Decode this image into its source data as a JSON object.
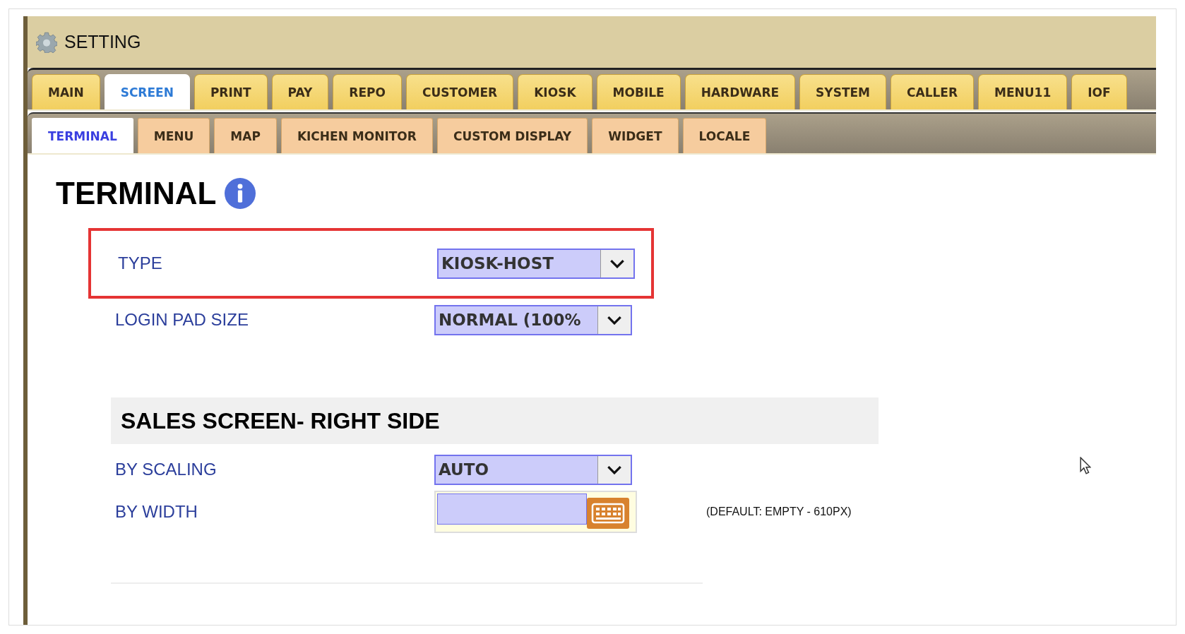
{
  "window": {
    "title": "SETTING"
  },
  "main_tabs": [
    {
      "label": "MAIN",
      "selected": false
    },
    {
      "label": "SCREEN",
      "selected": true
    },
    {
      "label": "PRINT",
      "selected": false
    },
    {
      "label": "PAY",
      "selected": false
    },
    {
      "label": "REPO",
      "selected": false
    },
    {
      "label": "CUSTOMER",
      "selected": false
    },
    {
      "label": "KIOSK",
      "selected": false
    },
    {
      "label": "MOBILE",
      "selected": false
    },
    {
      "label": "HARDWARE",
      "selected": false
    },
    {
      "label": "SYSTEM",
      "selected": false
    },
    {
      "label": "CALLER",
      "selected": false
    },
    {
      "label": "MENU11",
      "selected": false
    },
    {
      "label": "IOF",
      "selected": false
    }
  ],
  "sub_tabs": [
    {
      "label": "TERMINAL",
      "selected": true
    },
    {
      "label": "MENU",
      "selected": false
    },
    {
      "label": "MAP",
      "selected": false
    },
    {
      "label": "KICHEN MONITOR",
      "selected": false
    },
    {
      "label": "CUSTOM DISPLAY",
      "selected": false
    },
    {
      "label": "WIDGET",
      "selected": false
    },
    {
      "label": "LOCALE",
      "selected": false
    }
  ],
  "page": {
    "title": "TERMINAL"
  },
  "fields": [
    {
      "kind": "select",
      "label": "TYPE",
      "value": "KIOSK-HOST",
      "highlighted": true
    },
    {
      "kind": "select",
      "label": "LOGIN PAD SIZE",
      "value": "NORMAL (100%",
      "highlighted": false
    }
  ],
  "section": {
    "title": "SALES SCREEN- RIGHT SIDE"
  },
  "section_fields": [
    {
      "kind": "select",
      "label": "BY SCALING",
      "value": "AUTO",
      "highlighted": false
    },
    {
      "kind": "keyboard_input",
      "label": "BY WIDTH",
      "note": "(DEFAULT: EMPTY - 610PX)",
      "highlighted": false
    }
  ]
}
